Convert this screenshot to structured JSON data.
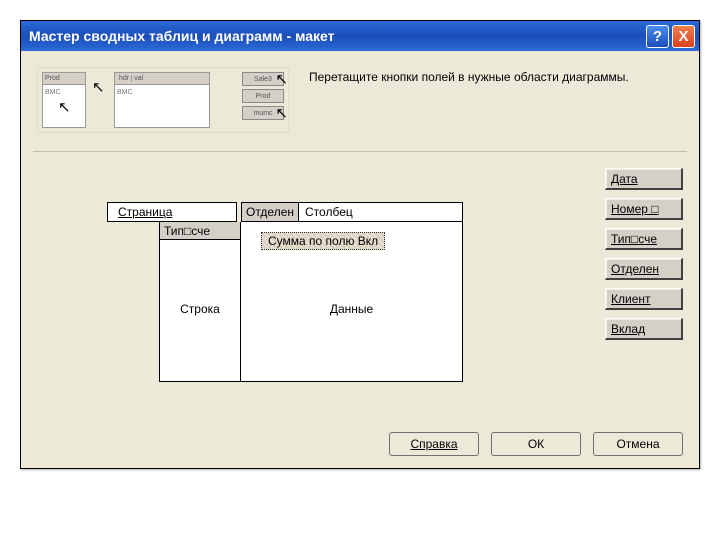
{
  "title": "Мастер сводных таблиц и диаграмм - макет",
  "instruction": "Перетащите кнопки полей в нужные области диаграммы.",
  "zones": {
    "page_label": "Страница",
    "column_label": "Столбец",
    "row_label": "Строка",
    "data_label": "Данные"
  },
  "placed": {
    "column_field": "Отделен",
    "row_field": "Тип□сче",
    "data_field": "Сумма по полю Вкл"
  },
  "fields": [
    "Дата",
    "Номер □",
    "Тип□сче",
    "Отделен",
    "Клиент",
    "Вклад"
  ],
  "buttons": {
    "help": "Справка",
    "ok": "ОК",
    "cancel": "Отмена"
  }
}
